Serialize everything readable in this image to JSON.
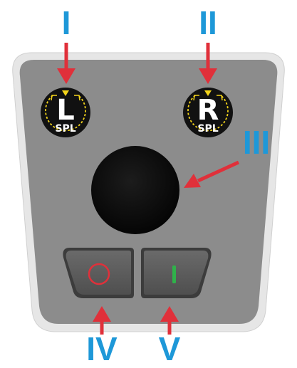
{
  "callouts": {
    "i": "I",
    "ii": "II",
    "iii": "III",
    "iv": "IV",
    "v": "V"
  },
  "knobs": {
    "left": {
      "letter": "L",
      "sub": "SPL"
    },
    "right": {
      "letter": "R",
      "sub": "SPL"
    }
  },
  "colors": {
    "callout": "#1e98d8",
    "arrow": "#e0303a",
    "panel": "#8c8c8c",
    "knob": "#111111",
    "ring": "#f2d31a",
    "off_symbol": "#e0303a",
    "on_symbol": "#2fb24a"
  },
  "icons": {
    "off_button_symbol": "power-off-circle",
    "on_button_symbol": "power-on-bar"
  }
}
